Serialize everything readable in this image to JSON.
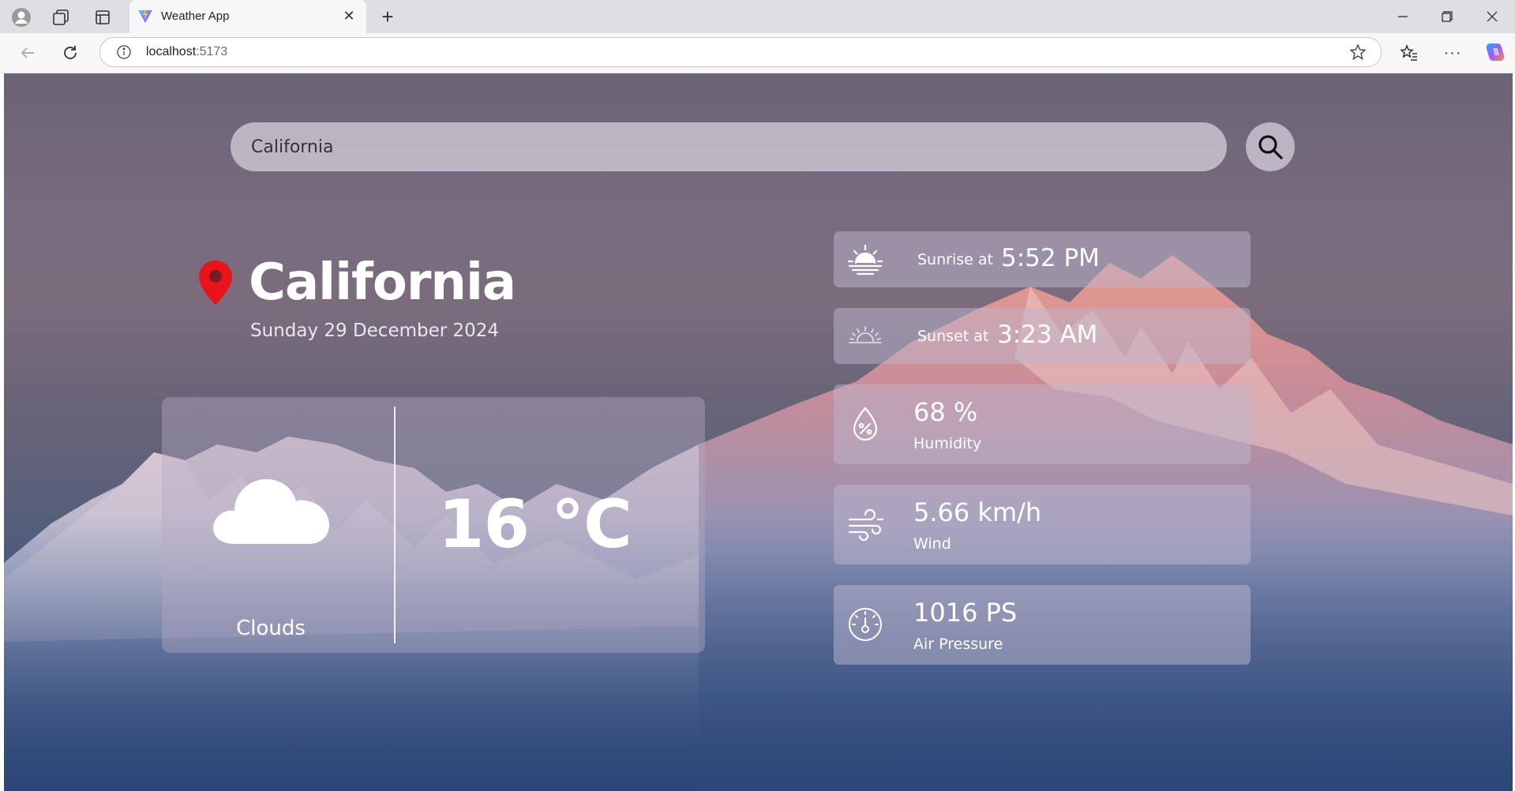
{
  "browser": {
    "tab_title": "Weather App",
    "address_host": "localhost",
    "address_port": ":5173"
  },
  "search": {
    "value": "California"
  },
  "location": {
    "city": "California",
    "date": "Sunday 29 December 2024"
  },
  "current": {
    "condition": "Clouds",
    "temperature": "16 °C",
    "icon": "cloud-icon"
  },
  "sunrise": {
    "label": "Sunrise at",
    "time": "5:52 PM"
  },
  "sunset": {
    "label": "Sunset at",
    "time": "3:23 AM"
  },
  "humidity": {
    "value": "68 %",
    "label": "Humidity"
  },
  "wind": {
    "value": "5.66 km/h",
    "label": "Wind"
  },
  "pressure": {
    "value": "1016 PS",
    "label": "Air Pressure"
  },
  "colors": {
    "pin": "#e8141c",
    "text": "#ffffff",
    "card": "rgba(190,182,205,0.5)"
  }
}
